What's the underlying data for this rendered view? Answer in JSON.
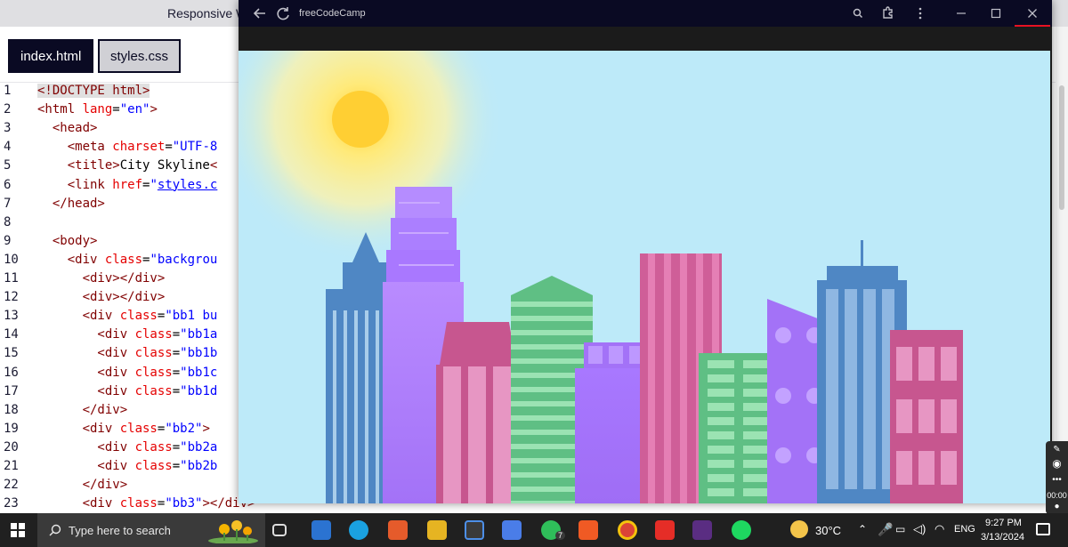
{
  "editor": {
    "topbar_title": "Responsive W",
    "tabs": [
      {
        "label": "index.html",
        "active": true
      },
      {
        "label": "styles.css",
        "active": false
      }
    ],
    "line_numbers": [
      "1",
      "2",
      "3",
      "4",
      "5",
      "6",
      "7",
      "8",
      "9",
      "10",
      "11",
      "12",
      "13",
      "14",
      "15",
      "16",
      "17",
      "18",
      "19",
      "20",
      "21",
      "22",
      "23"
    ],
    "code_lines": [
      [
        {
          "t": "<!DOCTYPE html>",
          "c": "tg hl"
        }
      ],
      [
        {
          "t": "<html ",
          "c": "tg"
        },
        {
          "t": "lang",
          "c": "at"
        },
        {
          "t": "=",
          "c": "tx"
        },
        {
          "t": "\"en\"",
          "c": "st"
        },
        {
          "t": ">",
          "c": "tg"
        }
      ],
      [
        {
          "t": "  <head>",
          "c": "tg"
        }
      ],
      [
        {
          "t": "    <meta ",
          "c": "tg"
        },
        {
          "t": "charset",
          "c": "at"
        },
        {
          "t": "=",
          "c": "tx"
        },
        {
          "t": "\"UTF-8",
          "c": "st"
        }
      ],
      [
        {
          "t": "    <title>",
          "c": "tg"
        },
        {
          "t": "City Skyline",
          "c": "tx"
        },
        {
          "t": "<",
          "c": "tg"
        }
      ],
      [
        {
          "t": "    <link ",
          "c": "tg"
        },
        {
          "t": "href",
          "c": "at"
        },
        {
          "t": "=",
          "c": "tx"
        },
        {
          "t": "\"",
          "c": "st"
        },
        {
          "t": "styles.c",
          "c": "ul"
        }
      ],
      [
        {
          "t": "  </head>",
          "c": "tg"
        }
      ],
      [],
      [
        {
          "t": "  <body>",
          "c": "tg"
        }
      ],
      [
        {
          "t": "    <div ",
          "c": "tg"
        },
        {
          "t": "class",
          "c": "at"
        },
        {
          "t": "=",
          "c": "tx"
        },
        {
          "t": "\"backgrou",
          "c": "st"
        }
      ],
      [
        {
          "t": "      <div></div>",
          "c": "tg"
        }
      ],
      [
        {
          "t": "      <div></div>",
          "c": "tg"
        }
      ],
      [
        {
          "t": "      <div ",
          "c": "tg"
        },
        {
          "t": "class",
          "c": "at"
        },
        {
          "t": "=",
          "c": "tx"
        },
        {
          "t": "\"bb1 bu",
          "c": "st"
        }
      ],
      [
        {
          "t": "        <div ",
          "c": "tg"
        },
        {
          "t": "class",
          "c": "at"
        },
        {
          "t": "=",
          "c": "tx"
        },
        {
          "t": "\"bb1a",
          "c": "st"
        }
      ],
      [
        {
          "t": "        <div ",
          "c": "tg"
        },
        {
          "t": "class",
          "c": "at"
        },
        {
          "t": "=",
          "c": "tx"
        },
        {
          "t": "\"bb1b",
          "c": "st"
        }
      ],
      [
        {
          "t": "        <div ",
          "c": "tg"
        },
        {
          "t": "class",
          "c": "at"
        },
        {
          "t": "=",
          "c": "tx"
        },
        {
          "t": "\"bb1c",
          "c": "st"
        }
      ],
      [
        {
          "t": "        <div ",
          "c": "tg"
        },
        {
          "t": "class",
          "c": "at"
        },
        {
          "t": "=",
          "c": "tx"
        },
        {
          "t": "\"bb1d",
          "c": "st"
        }
      ],
      [
        {
          "t": "      </div>",
          "c": "tg"
        }
      ],
      [
        {
          "t": "      <div ",
          "c": "tg"
        },
        {
          "t": "class",
          "c": "at"
        },
        {
          "t": "=",
          "c": "tx"
        },
        {
          "t": "\"bb2\"",
          "c": "st"
        },
        {
          "t": ">",
          "c": "tg"
        }
      ],
      [
        {
          "t": "        <div ",
          "c": "tg"
        },
        {
          "t": "class",
          "c": "at"
        },
        {
          "t": "=",
          "c": "tx"
        },
        {
          "t": "\"bb2a",
          "c": "st"
        }
      ],
      [
        {
          "t": "        <div ",
          "c": "tg"
        },
        {
          "t": "class",
          "c": "at"
        },
        {
          "t": "=",
          "c": "tx"
        },
        {
          "t": "\"bb2b",
          "c": "st"
        }
      ],
      [
        {
          "t": "      </div>",
          "c": "tg"
        }
      ],
      [
        {
          "t": "      <div ",
          "c": "tg"
        },
        {
          "t": "class",
          "c": "at"
        },
        {
          "t": "=",
          "c": "tx"
        },
        {
          "t": "\"bb3\"",
          "c": "st"
        },
        {
          "t": "></div>",
          "c": "tg"
        }
      ]
    ]
  },
  "preview": {
    "window_title": "freeCodeCamp",
    "icons": [
      "back-arrow-icon",
      "refresh-icon",
      "zoom-icon",
      "extensions-icon",
      "more-icon",
      "minimize-icon",
      "maximize-icon",
      "close-icon"
    ],
    "sky_color": "#bdeaf9",
    "sun_color": "#ffcf33"
  },
  "taskbar": {
    "search_placeholder": "Type here to search",
    "weather_temp": "30°C",
    "language": "ENG",
    "time": "9:27 PM",
    "date": "3/13/2024",
    "whatsapp_badge": "7",
    "sidepanel_time": "00:00"
  }
}
